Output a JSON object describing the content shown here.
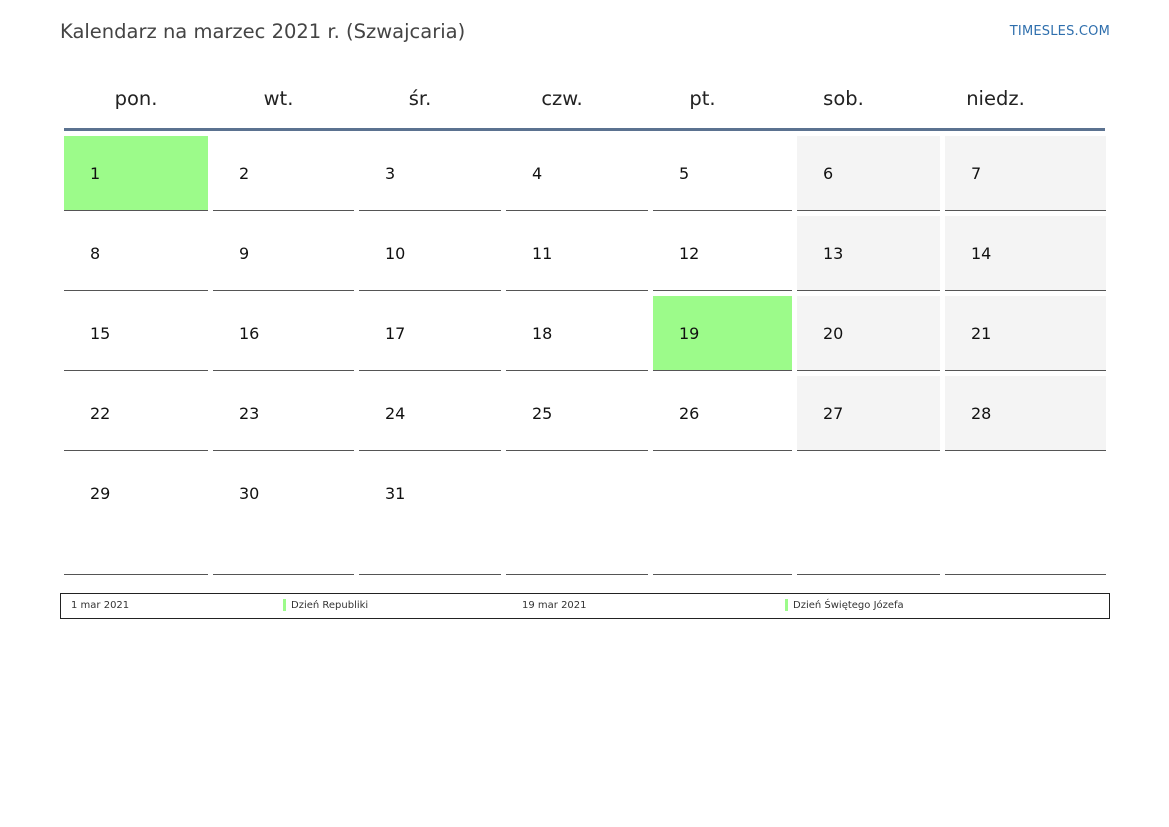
{
  "header": {
    "title": "Kalendarz na marzec 2021 r. (Szwajcaria)",
    "brand": "TIMESLES.COM"
  },
  "colors": {
    "holiday": "#9cfb8a",
    "weekend": "#f4f4f4",
    "header_rule": "#5b7290",
    "brand": "#2f6fad"
  },
  "weekdays": [
    "pon.",
    "wt.",
    "śr.",
    "czw.",
    "pt.",
    "sob.",
    "niedz."
  ],
  "weeks": [
    [
      "1",
      "2",
      "3",
      "4",
      "5",
      "6",
      "7"
    ],
    [
      "8",
      "9",
      "10",
      "11",
      "12",
      "13",
      "14"
    ],
    [
      "15",
      "16",
      "17",
      "18",
      "19",
      "20",
      "21"
    ],
    [
      "22",
      "23",
      "24",
      "25",
      "26",
      "27",
      "28"
    ],
    [
      "29",
      "30",
      "31",
      "",
      "",
      "",
      ""
    ]
  ],
  "holidays": [
    {
      "date": "1 mar 2021",
      "name": "Dzień Republiki"
    },
    {
      "date": "19 mar 2021",
      "name": "Dzień Świętego Józefa"
    }
  ]
}
